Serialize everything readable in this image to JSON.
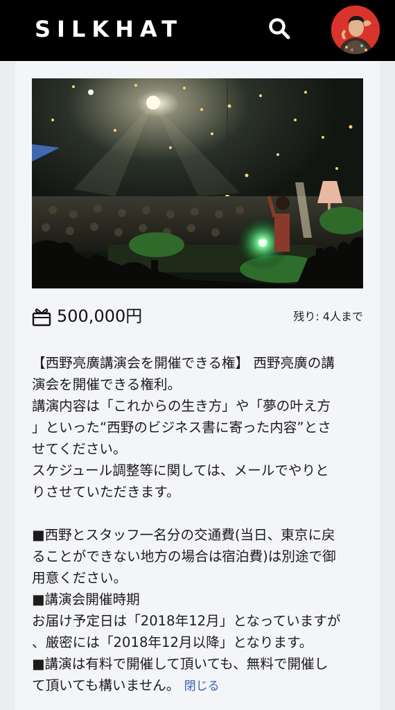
{
  "header": {
    "logo": "SILKHAT",
    "icons": {
      "search": "search-icon",
      "avatar": "user-avatar"
    },
    "colors": {
      "background": "#000000",
      "logo": "#ffffff",
      "avatar_bg": "#d9342b"
    }
  },
  "reward": {
    "icons": {
      "price": "gift-icon"
    },
    "price": "500,000円",
    "remaining": "残り: 4人まで",
    "description_lines": [
      "【西野亮廣講演会を開催できる権】 西野亮廣の講",
      "演会を開催できる権利。",
      "講演内容は「これからの生き方」や「夢の叶え方",
      "」といった“西野のビジネス書に寄った内容”とさ",
      "せてください。",
      "スケジュール調整等に関しては、メールでやりと",
      "りさせていただきます。",
      "",
      "■西野とスタッフ一名分の交通費(当日、東京に戻",
      "ることができない地方の場合は宿泊費)は別途で御",
      "用意ください。",
      "■講演会開催時期",
      "お届け予定日は「2018年12月」となっていますが",
      "、厳密には「2018年12月以降」となります。",
      "■講演は有料で開催して頂いても、無料で開催し",
      "て頂いても構いません。"
    ],
    "close_label": "閉じる",
    "colors": {
      "link": "#3b63b0",
      "card": "#f4f5f8"
    }
  }
}
